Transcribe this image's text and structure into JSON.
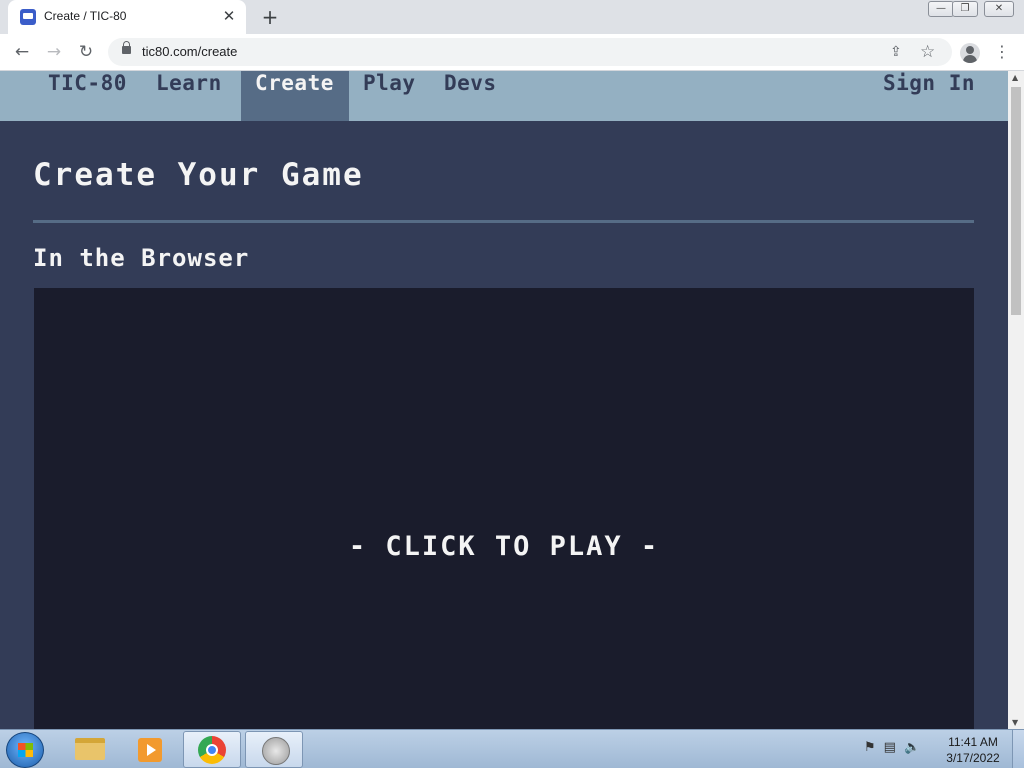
{
  "browser": {
    "tab_title": "Create / TIC-80",
    "tab_close": "✕",
    "new_tab": "+",
    "url": "tic80.com/create",
    "window_buttons": {
      "minimize": "—",
      "maximize": "❐",
      "close": "✕"
    },
    "nav": {
      "back": "←",
      "forward": "→",
      "reload": "↻"
    },
    "icons": {
      "share": "⇪",
      "star": "☆",
      "menu": "⋮"
    }
  },
  "site": {
    "nav": {
      "logo": "TIC-80",
      "learn": "Learn",
      "create": "Create",
      "play": "Play",
      "devs": "Devs",
      "sign_in": "Sign In"
    },
    "page_title": "Create Your Game",
    "section_title": "In the Browser",
    "player_prompt": "- CLICK TO PLAY -",
    "colors": {
      "nav_bg": "#94b0c2",
      "nav_active_bg": "#566c86",
      "page_bg": "#333c57",
      "player_bg": "#1a1c2c",
      "text": "#f4f4f4"
    }
  },
  "taskbar": {
    "clock_time": "11:41 AM",
    "clock_date": "3/17/2022",
    "tray_icons": [
      "flag-icon",
      "network-icon",
      "volume-icon"
    ]
  }
}
